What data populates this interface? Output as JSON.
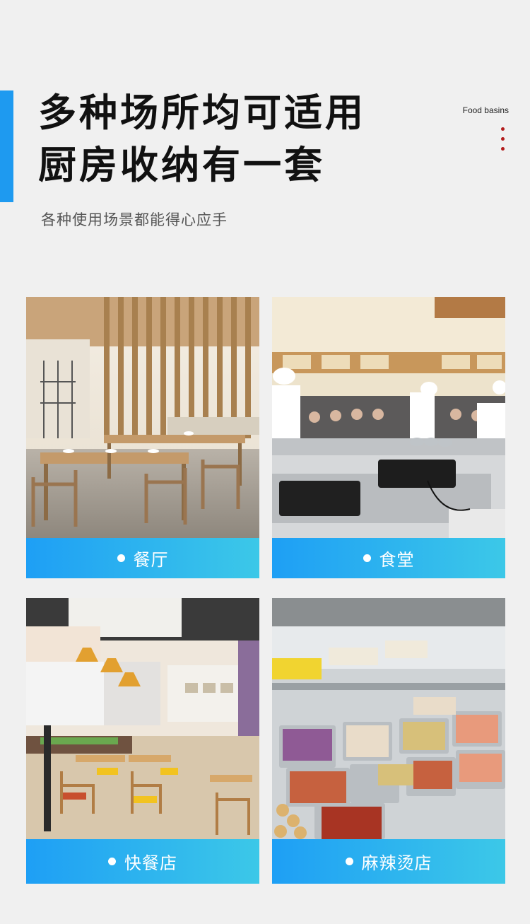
{
  "header": {
    "title_line1": "多种场所均可适用",
    "title_line2": "厨房收纳有一套",
    "subtitle": "各种使用场景都能得心应手",
    "brand": "Food basins"
  },
  "colors": {
    "accent": "#1e9af0",
    "label_gradient_start": "#1e9ff5",
    "label_gradient_end": "#3cc8e8",
    "dot_red": "#b21c1c"
  },
  "scenes": [
    {
      "label": "餐厅",
      "icon": "restaurant-photo"
    },
    {
      "label": "食堂",
      "icon": "canteen-photo"
    },
    {
      "label": "快餐店",
      "icon": "fast-food-photo"
    },
    {
      "label": "麻辣烫店",
      "icon": "malatang-photo"
    }
  ]
}
